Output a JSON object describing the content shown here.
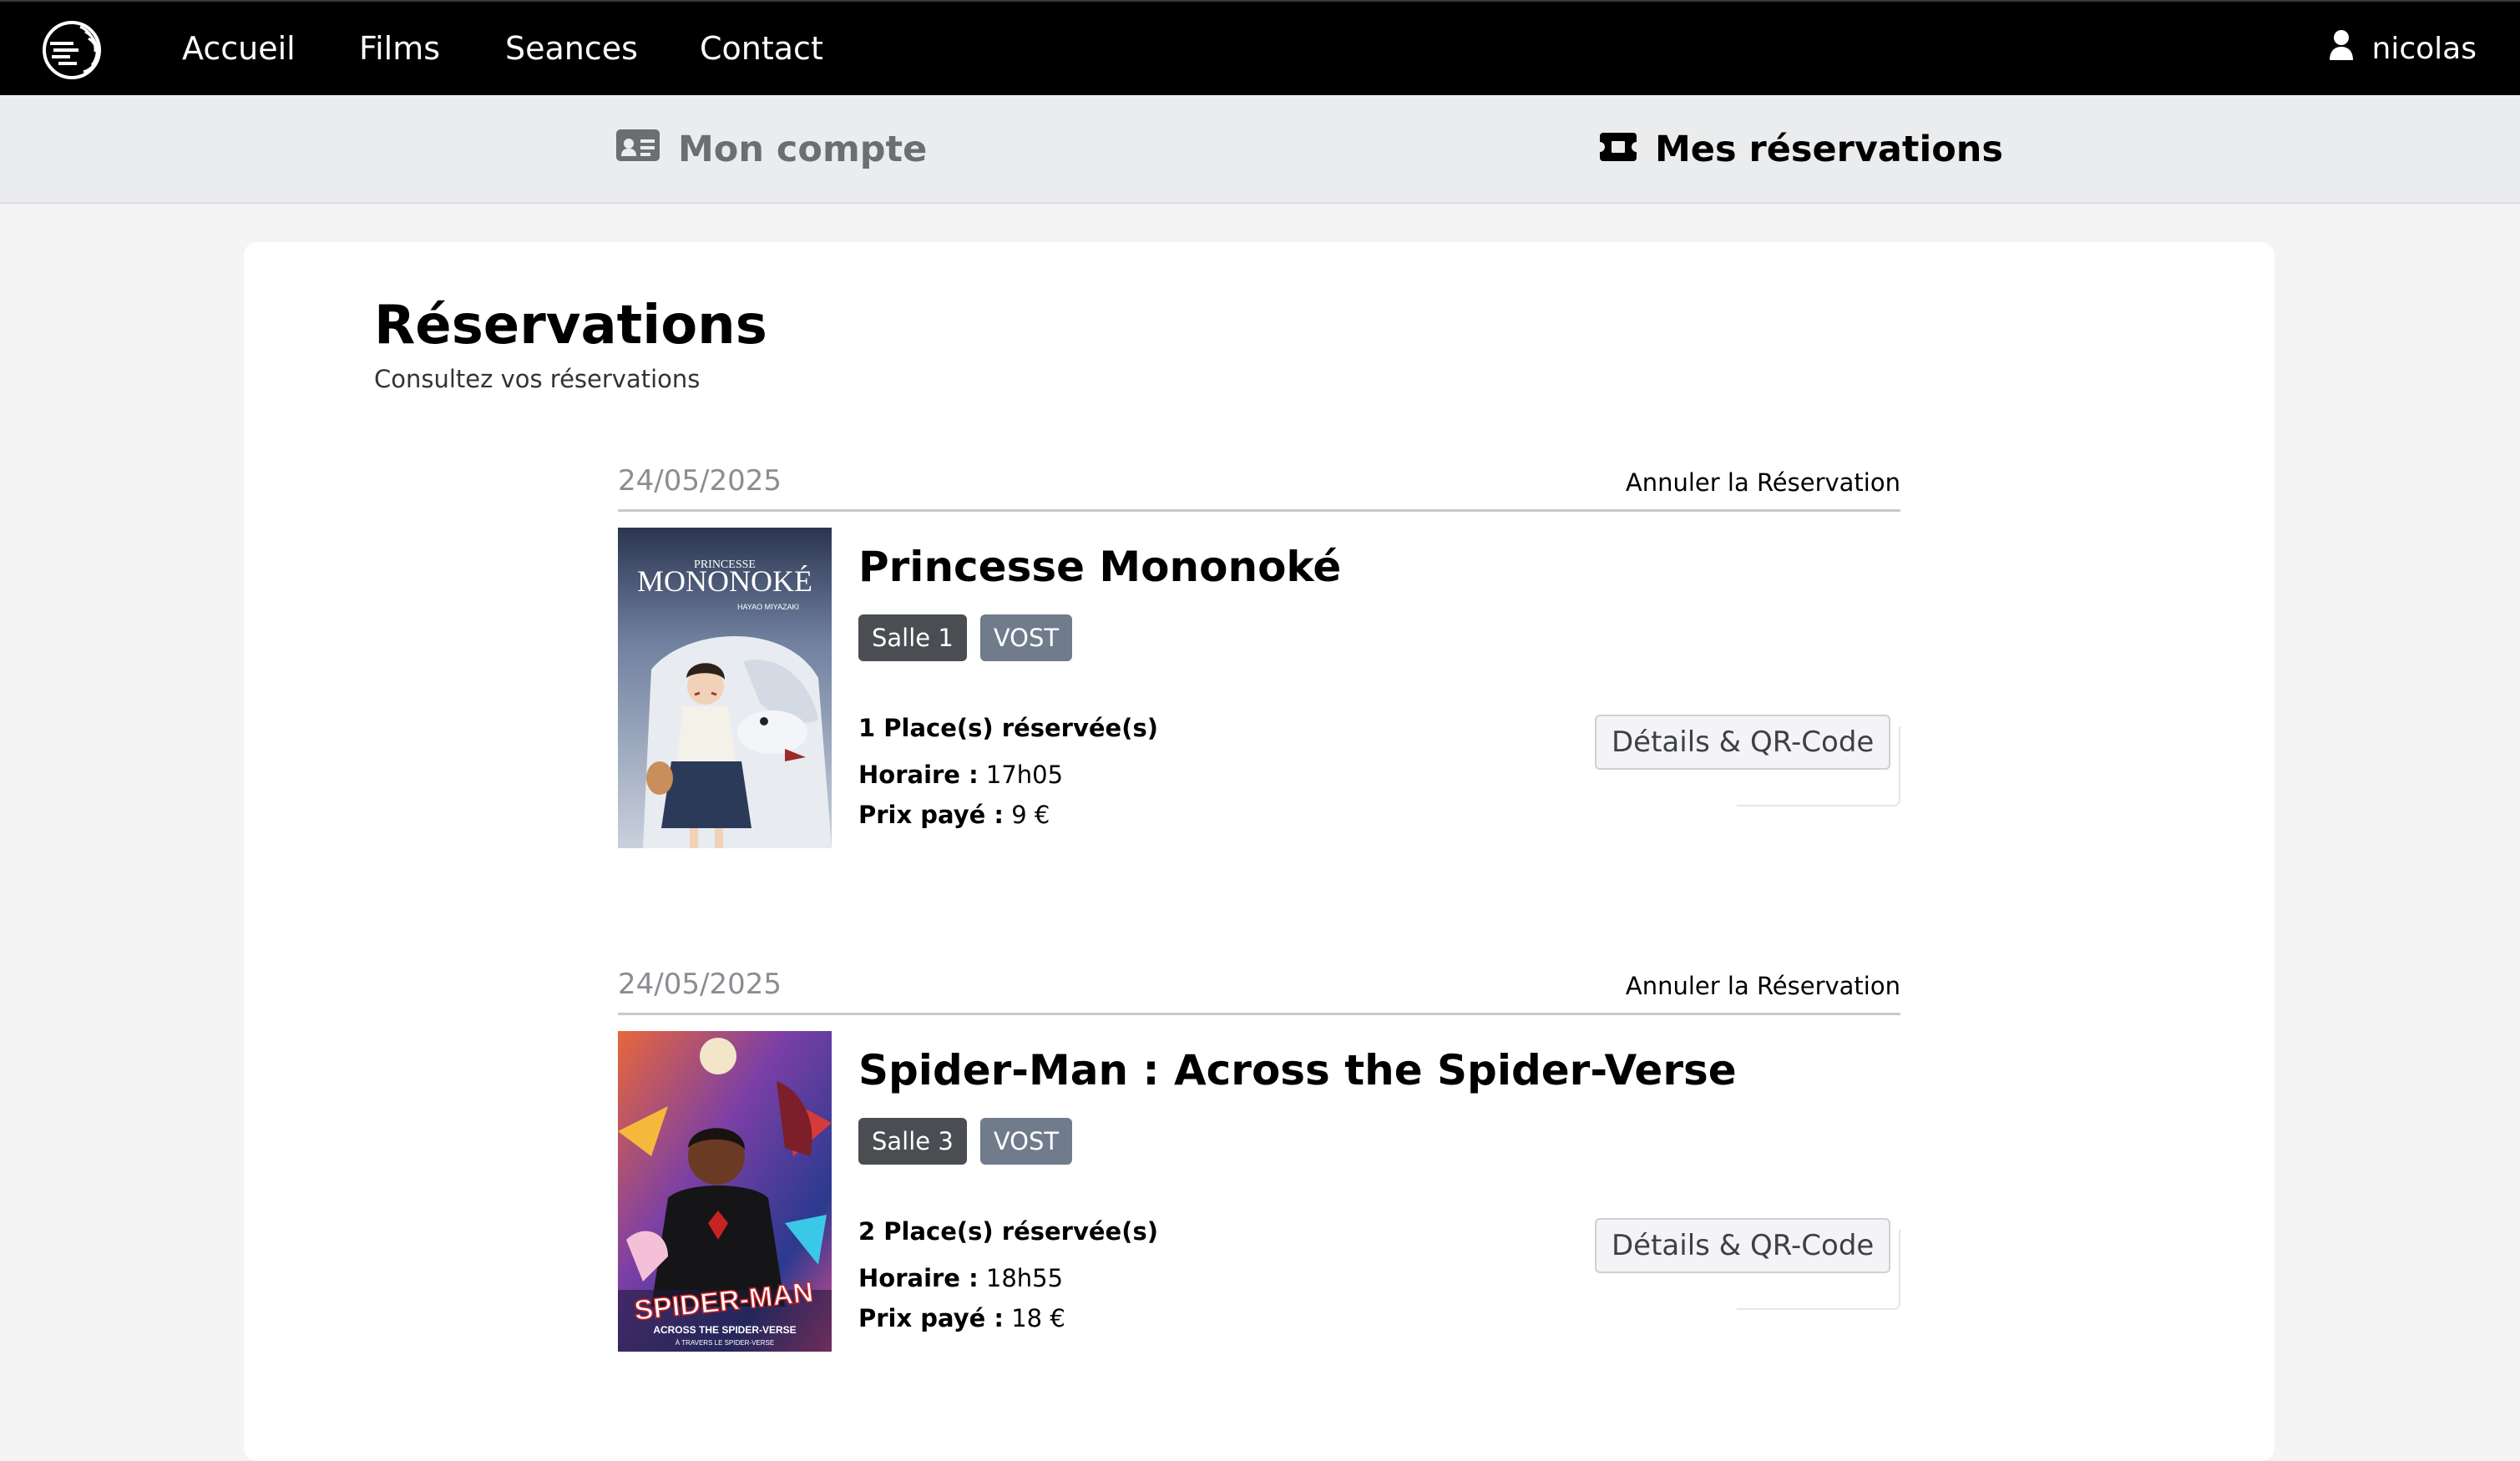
{
  "nav": {
    "links": [
      "Accueil",
      "Films",
      "Seances",
      "Contact"
    ],
    "username": "nicolas"
  },
  "subnav": {
    "account_label": "Mon compte",
    "reservations_label": "Mes réservations"
  },
  "page": {
    "title": "Réservations",
    "subtitle": "Consultez vos réservations"
  },
  "reservations": [
    {
      "date": "24/05/2025",
      "cancel_label": "Annuler la Réservation",
      "film_title": "Princesse Mononoké",
      "room": "Salle 1",
      "version": "VOST",
      "places": "1 Place(s) réservée(s)",
      "time_label": "Horaire :",
      "time": "17h05",
      "price_label": "Prix payé :",
      "price": "9 €",
      "details_label": "Détails & QR-Code",
      "poster_text_top": "PRINCESSE",
      "poster_text_main": "MONONOKÉ",
      "poster_text_small": "HAYAO MIYAZAKI"
    },
    {
      "date": "24/05/2025",
      "cancel_label": "Annuler la Réservation",
      "film_title": "Spider-Man : Across the Spider-Verse",
      "room": "Salle 3",
      "version": "VOST",
      "places": "2 Place(s) réservée(s)",
      "time_label": "Horaire :",
      "time": "18h55",
      "price_label": "Prix payé :",
      "price": "18 €",
      "details_label": "Détails & QR-Code",
      "poster_text_main": "SPIDER-MAN",
      "poster_text_small": "ACROSS THE SPIDER-VERSE",
      "poster_text_tiny": "À TRAVERS LE SPIDER-VERSE"
    }
  ],
  "colors": {
    "navbar_bg": "#000000",
    "subnav_bg": "#ebecee",
    "badge_room": "#4a4d52",
    "badge_version": "#707b8c"
  }
}
